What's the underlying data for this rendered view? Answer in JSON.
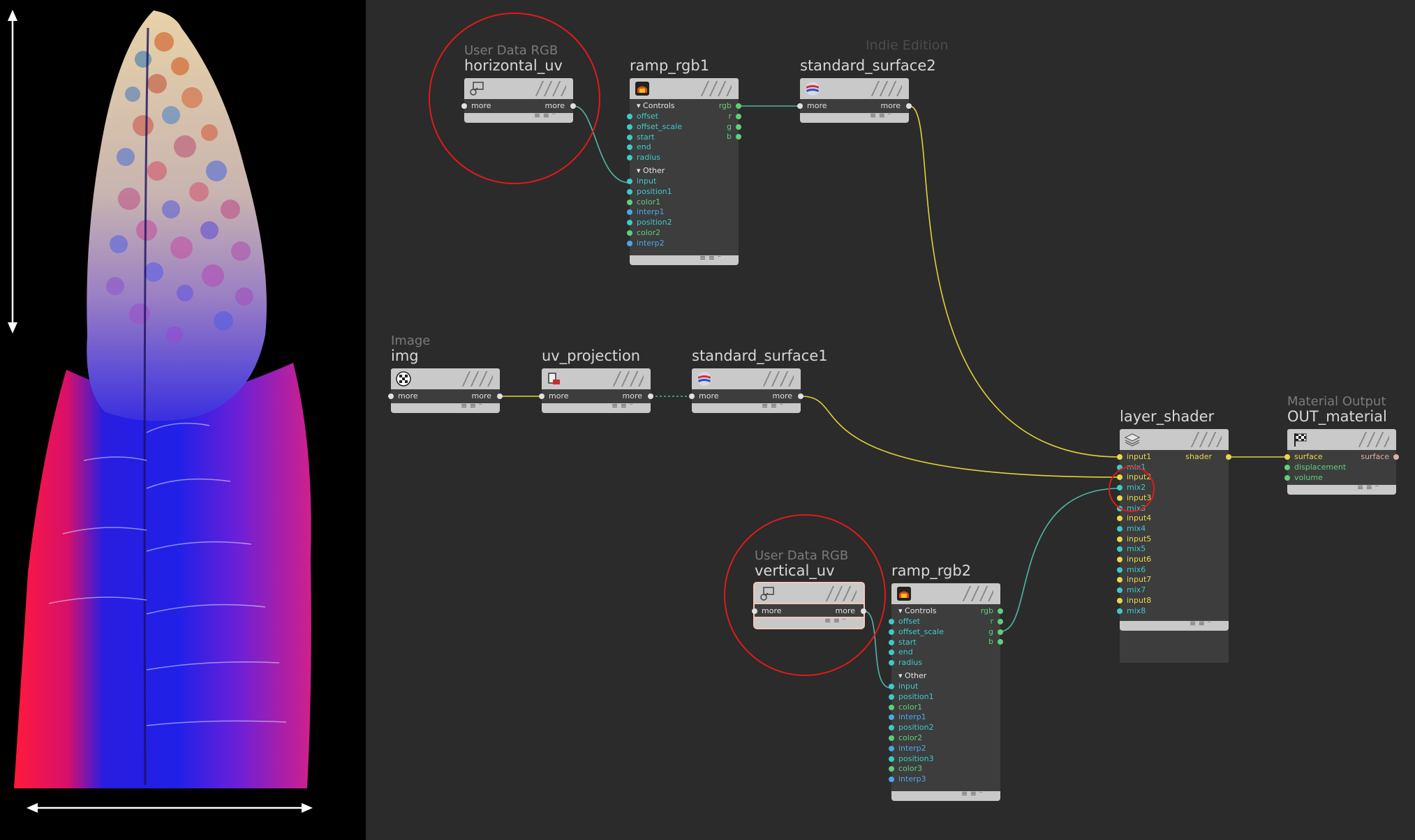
{
  "edition_label": "Indie Edition",
  "colors": {
    "graph_bg": "#2b2b2b",
    "wire_teal": "#4fb8a8",
    "wire_yellow": "#e2d13a",
    "port_green": "#5fcf7a",
    "port_blue": "#4aa8e8",
    "port_cyan": "#3fc9c9",
    "port_yellow": "#e8d84a",
    "highlight": "#e01a1a"
  },
  "nodes": {
    "horizontal_uv": {
      "subtitle": "User Data RGB",
      "name": "horizontal_uv",
      "icon": "user-data-icon",
      "in": "more",
      "out": "more"
    },
    "ramp_rgb1": {
      "name": "ramp_rgb1",
      "icon": "ramp-icon",
      "controls_label": "Controls",
      "controls": [
        "offset",
        "offset_scale",
        "start",
        "end",
        "radius"
      ],
      "other_label": "Other",
      "other": [
        "input",
        "position1",
        "color1",
        "interp1",
        "position2",
        "color2",
        "interp2"
      ],
      "outputs": [
        "rgb",
        "r",
        "g",
        "b"
      ]
    },
    "standard_surface2": {
      "name": "standard_surface2",
      "icon": "shader-ball-icon",
      "in": "more",
      "out": "more"
    },
    "img": {
      "subtitle": "Image",
      "name": "img",
      "icon": "checker-icon",
      "in": "more",
      "out": "more"
    },
    "uv_projection": {
      "name": "uv_projection",
      "icon": "uv-projection-icon",
      "in": "more",
      "out": "more"
    },
    "standard_surface1": {
      "name": "standard_surface1",
      "icon": "shader-ball-icon",
      "in": "more",
      "out": "more"
    },
    "layer_shader": {
      "name": "layer_shader",
      "icon": "layers-icon",
      "inputs": [
        "input1",
        "mix1",
        "input2",
        "mix2",
        "input3",
        "mix3",
        "input4",
        "mix4",
        "input5",
        "mix5",
        "input6",
        "mix6",
        "input7",
        "mix7",
        "input8",
        "mix8"
      ],
      "output": "shader"
    },
    "out_material": {
      "subtitle": "Material Output",
      "name": "OUT_material",
      "icon": "checkered-flag-icon",
      "inputs": [
        "surface",
        "displacement",
        "volume"
      ],
      "output": "surface"
    },
    "vertical_uv": {
      "subtitle": "User Data RGB",
      "name": "vertical_uv",
      "icon": "user-data-icon",
      "in": "more",
      "out": "more"
    },
    "ramp_rgb2": {
      "name": "ramp_rgb2",
      "icon": "ramp-icon",
      "controls_label": "Controls",
      "controls": [
        "offset",
        "offset_scale",
        "start",
        "end",
        "radius"
      ],
      "other_label": "Other",
      "other": [
        "input",
        "position1",
        "color1",
        "interp1",
        "position2",
        "color2",
        "interp2",
        "position3",
        "color3",
        "interp3"
      ],
      "outputs": [
        "rgb",
        "r",
        "g",
        "b"
      ]
    }
  }
}
